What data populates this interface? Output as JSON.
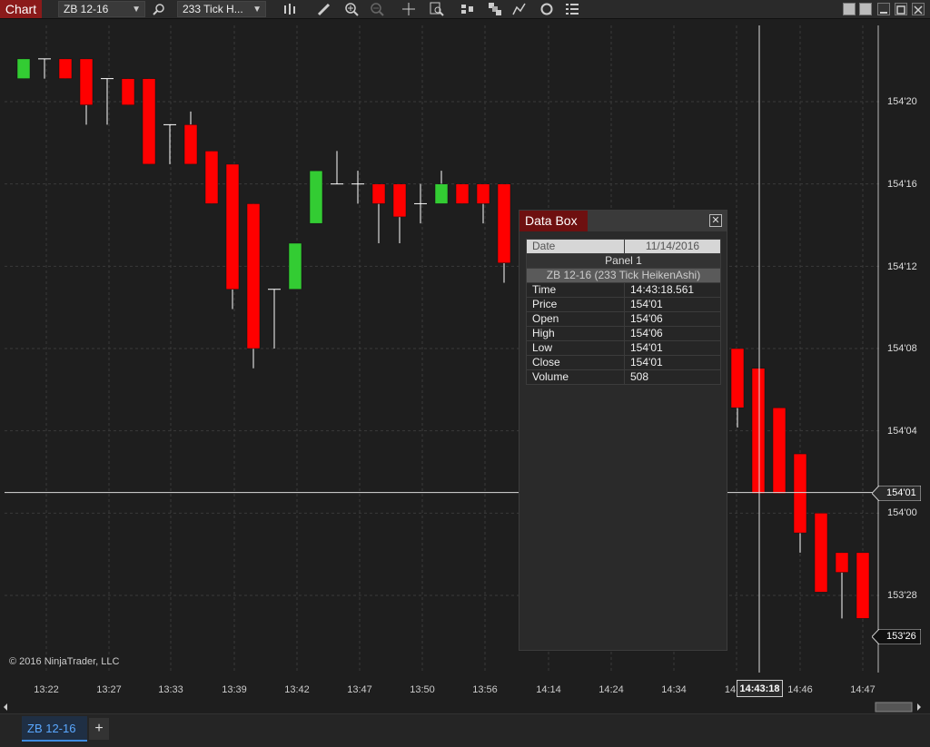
{
  "toolbar": {
    "chart_tab": "Chart",
    "instrument": "ZB 12-16",
    "interval": "233 Tick H...",
    "icons": [
      "search-icon",
      "bars-icon",
      "pencil-icon",
      "zoom-in-icon",
      "zoom-out-icon",
      "crosshair-icon",
      "zoom-box-icon",
      "strategy-icon",
      "stack-icon",
      "indicator-icon",
      "refresh-icon",
      "properties-icon"
    ]
  },
  "chart": {
    "copyright": "© 2016 NinjaTrader, LLC",
    "price_labels": [
      "154'20",
      "154'16",
      "154'12",
      "154'08",
      "154'04",
      "154'00",
      "153'28"
    ],
    "current_price_label": "154'01",
    "last_price_label": "153'26",
    "time_labels": [
      "13:22",
      "13:27",
      "13:33",
      "13:39",
      "13:42",
      "13:47",
      "13:50",
      "13:56",
      "14:14",
      "14:24",
      "14:34",
      "14",
      "14:46",
      "14:47"
    ],
    "crosshair_time": "14:43:18",
    "colors": {
      "up": "#33cc33",
      "down": "#ff0000",
      "wick": "#ffffff",
      "background": "#1e1e1e",
      "grid": "#3a3a3a"
    }
  },
  "chart_data": {
    "type": "candlestick",
    "title": "",
    "series_label": "ZB 12-16 (233 Tick HeikenAshi)",
    "y_axis": {
      "ticks": [
        "153'28",
        "154'00",
        "154'04",
        "154'08",
        "154'12",
        "154'16",
        "154'20"
      ],
      "range": [
        153.75,
        154.72
      ]
    },
    "x_axis": {
      "ticks": [
        "13:22",
        "13:27",
        "13:33",
        "13:39",
        "13:42",
        "13:47",
        "13:50",
        "13:56",
        "14:14",
        "14:24",
        "14:34",
        "14:46",
        "14:47"
      ]
    },
    "candles": [
      {
        "o": 154.66,
        "c": 154.69,
        "h": 154.69,
        "l": 154.66
      },
      {
        "o": 154.69,
        "c": 154.69,
        "h": 154.69,
        "l": 154.66
      },
      {
        "o": 154.69,
        "c": 154.66,
        "h": 154.69,
        "l": 154.66
      },
      {
        "o": 154.69,
        "c": 154.62,
        "h": 154.69,
        "l": 154.59
      },
      {
        "o": 154.66,
        "c": 154.66,
        "h": 154.66,
        "l": 154.59
      },
      {
        "o": 154.66,
        "c": 154.62,
        "h": 154.66,
        "l": 154.62
      },
      {
        "o": 154.66,
        "c": 154.53,
        "h": 154.66,
        "l": 154.53
      },
      {
        "o": 154.59,
        "c": 154.59,
        "h": 154.59,
        "l": 154.53
      },
      {
        "o": 154.59,
        "c": 154.53,
        "h": 154.61,
        "l": 154.53
      },
      {
        "o": 154.55,
        "c": 154.47,
        "h": 154.55,
        "l": 154.47
      },
      {
        "o": 154.53,
        "c": 154.34,
        "h": 154.53,
        "l": 154.31
      },
      {
        "o": 154.47,
        "c": 154.25,
        "h": 154.47,
        "l": 154.22
      },
      {
        "o": 154.34,
        "c": 154.34,
        "h": 154.34,
        "l": 154.25
      },
      {
        "o": 154.34,
        "c": 154.41,
        "h": 154.41,
        "l": 154.34
      },
      {
        "o": 154.44,
        "c": 154.52,
        "h": 154.52,
        "l": 154.44
      },
      {
        "o": 154.5,
        "c": 154.5,
        "h": 154.55,
        "l": 154.5
      },
      {
        "o": 154.5,
        "c": 154.5,
        "h": 154.52,
        "l": 154.47
      },
      {
        "o": 154.5,
        "c": 154.47,
        "h": 154.5,
        "l": 154.41
      },
      {
        "o": 154.5,
        "c": 154.45,
        "h": 154.5,
        "l": 154.41
      },
      {
        "o": 154.47,
        "c": 154.47,
        "h": 154.5,
        "l": 154.44
      },
      {
        "o": 154.47,
        "c": 154.5,
        "h": 154.52,
        "l": 154.47
      },
      {
        "o": 154.5,
        "c": 154.47,
        "h": 154.5,
        "l": 154.47
      },
      {
        "o": 154.5,
        "c": 154.47,
        "h": 154.5,
        "l": 154.44
      },
      {
        "o": 154.5,
        "c": 154.38,
        "h": 154.5,
        "l": 154.35
      },
      {
        "o": 154.25,
        "c": 154.16,
        "h": 154.25,
        "l": 154.13
      },
      {
        "o": 154.22,
        "c": 154.03,
        "h": 154.22,
        "l": 154.03
      },
      {
        "o": 154.16,
        "c": 154.03,
        "h": 154.16,
        "l": 154.03
      },
      {
        "o": 154.09,
        "c": 153.97,
        "h": 154.09,
        "l": 153.94
      },
      {
        "o": 154.0,
        "c": 153.88,
        "h": 154.0,
        "l": 153.88
      },
      {
        "o": 153.94,
        "c": 153.91,
        "h": 153.94,
        "l": 153.84
      },
      {
        "o": 153.94,
        "c": 153.84,
        "h": 153.94,
        "l": 153.84
      }
    ]
  },
  "databox": {
    "title": "Data Box",
    "date_label": "Date",
    "date_value": "11/14/2016",
    "panel": "Panel 1",
    "series": "ZB 12-16 (233 Tick HeikenAshi)",
    "rows": [
      {
        "label": "Time",
        "value": "14:43:18.561"
      },
      {
        "label": "Price",
        "value": "154'01"
      },
      {
        "label": "Open",
        "value": "154'06"
      },
      {
        "label": "High",
        "value": "154'06"
      },
      {
        "label": "Low",
        "value": "154'01"
      },
      {
        "label": "Close",
        "value": "154'01"
      },
      {
        "label": "Volume",
        "value": "508"
      }
    ]
  },
  "bottom_tabs": {
    "active_tab": "ZB 12-16",
    "add_label": "+"
  }
}
